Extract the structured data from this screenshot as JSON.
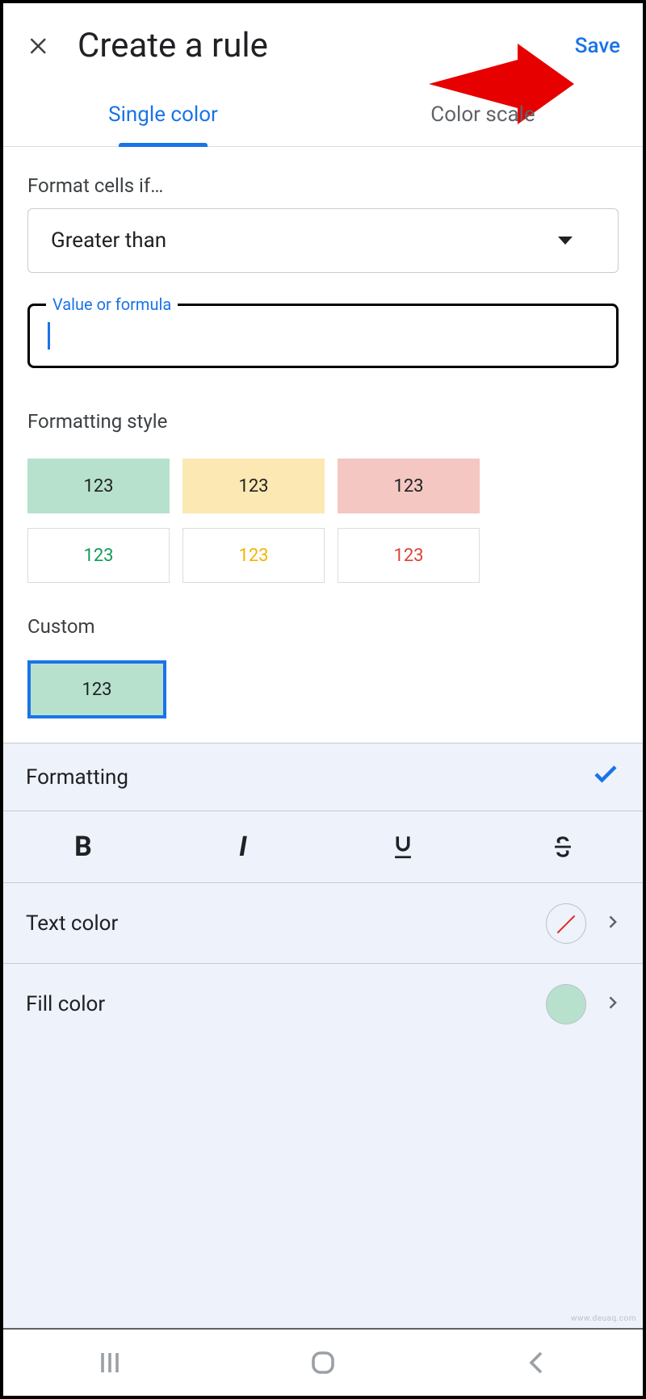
{
  "header": {
    "title": "Create a rule",
    "save_label": "Save"
  },
  "tabs": {
    "single_color": "Single color",
    "color_scale": "Color scale"
  },
  "format_section": {
    "label": "Format cells if…",
    "select_value": "Greater than",
    "input_label": "Value or formula",
    "input_value": ""
  },
  "style_section": {
    "label": "Formatting style",
    "swatch_text": "123",
    "custom_label": "Custom",
    "custom_text": "123"
  },
  "panel": {
    "header": "Formatting",
    "text_color_label": "Text color",
    "fill_color_label": "Fill color",
    "text_color_value": "none",
    "fill_color_value": "#b7e1cd"
  },
  "watermark": "www.deuaq.com"
}
